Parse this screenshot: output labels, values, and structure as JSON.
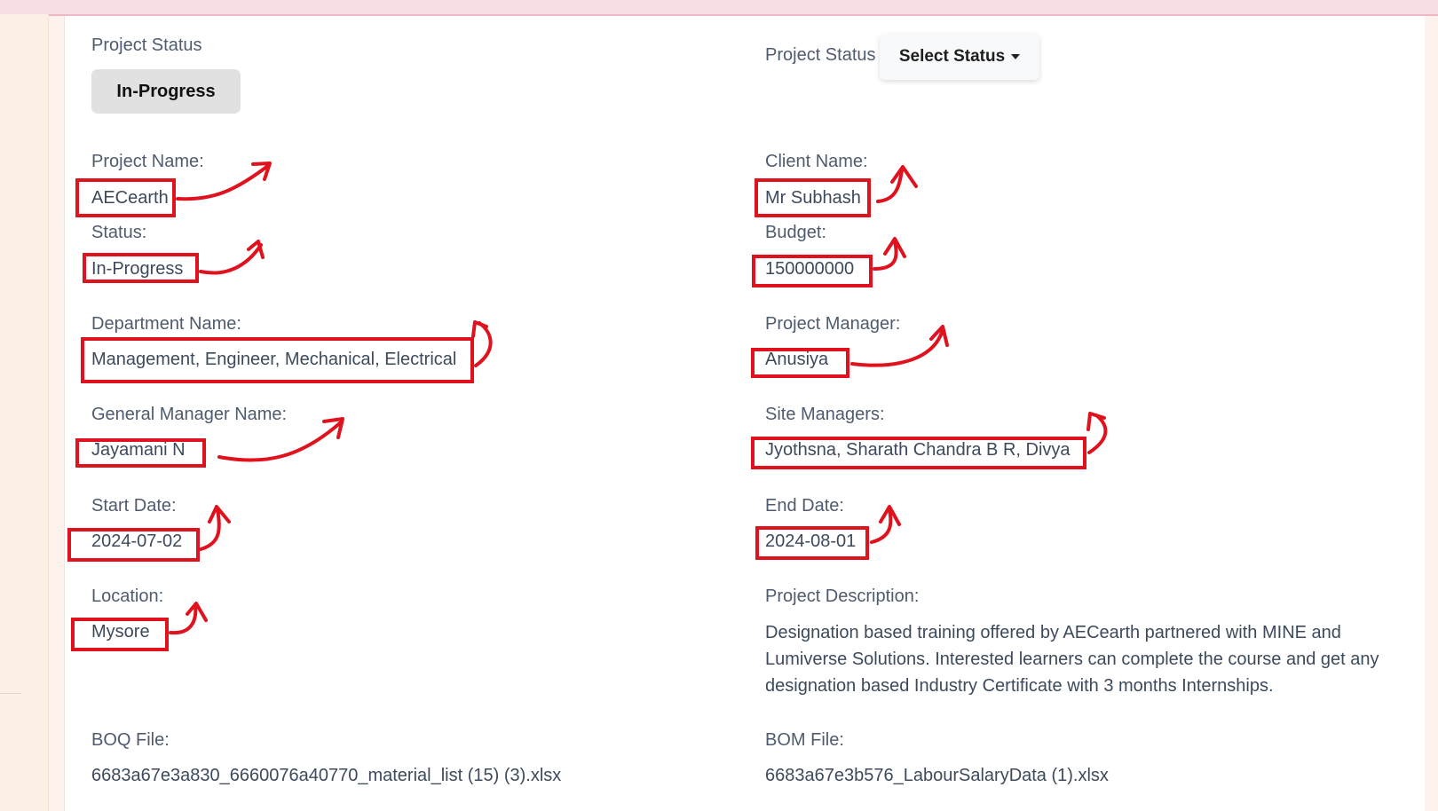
{
  "status_section": {
    "label": "Project Status",
    "current_status": "In-Progress",
    "select_label": "Project Status",
    "select_button": "Select Status"
  },
  "fields": {
    "project_name": {
      "label": "Project Name:",
      "value": "AECearth"
    },
    "status": {
      "label": "Status:",
      "value": "In-Progress"
    },
    "department_name": {
      "label": "Department Name:",
      "value": "Management, Engineer, Mechanical, Electrical"
    },
    "general_manager": {
      "label": "General Manager Name:",
      "value": "Jayamani N"
    },
    "start_date": {
      "label": "Start Date:",
      "value": "2024-07-02"
    },
    "location": {
      "label": "Location:",
      "value": "Mysore"
    },
    "client_name": {
      "label": "Client Name:",
      "value": "Mr Subhash"
    },
    "budget": {
      "label": "Budget:",
      "value": "150000000"
    },
    "project_manager": {
      "label": "Project Manager:",
      "value": "Anusiya"
    },
    "site_managers": {
      "label": "Site Managers:",
      "value": "Jyothsna, Sharath Chandra B R, Divya"
    },
    "end_date": {
      "label": "End Date:",
      "value": "2024-08-01"
    },
    "project_description": {
      "label": "Project Description:",
      "value": "Designation based training offered by AECearth partnered with MINE and Lumiverse Solutions. Interested learners can complete the course and get any designation based Industry Certificate with 3 months Internships."
    },
    "boq_file": {
      "label": "BOQ File:",
      "value": "6683a67e3a830_6660076a40770_material_list (15) (3).xlsx"
    },
    "bom_file": {
      "label": "BOM File:",
      "value": "6683a67e3b576_LabourSalaryData (1).xlsx"
    }
  },
  "colors": {
    "annotation": "#e0121e",
    "status_pill_bg": "#e1e1e1",
    "text": "#3d4a5c"
  }
}
